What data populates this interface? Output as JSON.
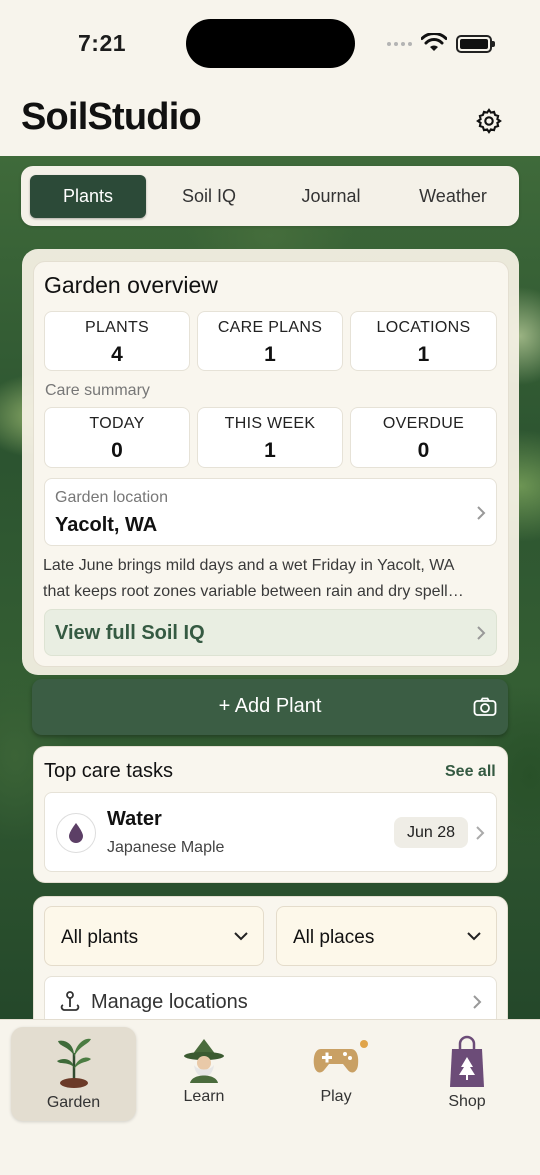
{
  "status_bar": {
    "time": "7:21"
  },
  "header": {
    "logo": "SoilStudio",
    "settings_icon": "gear-icon"
  },
  "tabs": [
    {
      "label": "Plants",
      "active": true
    },
    {
      "label": "Soil IQ",
      "active": false
    },
    {
      "label": "Journal",
      "active": false
    },
    {
      "label": "Weather",
      "active": false
    }
  ],
  "overview": {
    "title": "Garden overview",
    "stats": [
      {
        "label": "PLANTS",
        "value": "4"
      },
      {
        "label": "CARE PLANS",
        "value": "1"
      },
      {
        "label": "LOCATIONS",
        "value": "1"
      }
    ],
    "care_summary_label": "Care summary",
    "care_summary": [
      {
        "label": "TODAY",
        "value": "0"
      },
      {
        "label": "THIS WEEK",
        "value": "1"
      },
      {
        "label": "OVERDUE",
        "value": "0"
      }
    ],
    "location_label": "Garden location",
    "location_value": "Yacolt, WA",
    "description_line1": "Late June brings mild days and a wet Friday in Yacolt, WA",
    "description_line2": "that keeps root zones variable between rain and dry spell…",
    "soil_iq_link": "View full Soil IQ"
  },
  "add_plant": {
    "label": "+ Add Plant",
    "icon": "camera-icon"
  },
  "tasks": {
    "title": "Top care tasks",
    "see_all": "See all",
    "items": [
      {
        "name": "Water",
        "plant": "Japanese Maple",
        "date": "Jun 28",
        "icon": "water-drop-icon"
      }
    ]
  },
  "filters": {
    "plants_select": "All plants",
    "places_select": "All places",
    "manage_locations": "Manage locations"
  },
  "bottom_nav": [
    {
      "label": "Garden",
      "active": true,
      "icon": "sprout-icon"
    },
    {
      "label": "Learn",
      "active": false,
      "icon": "wizard-icon"
    },
    {
      "label": "Play",
      "active": false,
      "icon": "gamepad-icon"
    },
    {
      "label": "Shop",
      "active": false,
      "icon": "shopping-bag-icon"
    }
  ],
  "colors": {
    "primary_green": "#2c4a38",
    "button_green": "#3b5d44",
    "link_green": "#355a42",
    "background": "#f7f4ec",
    "badge_orange": "#e0a44a"
  }
}
